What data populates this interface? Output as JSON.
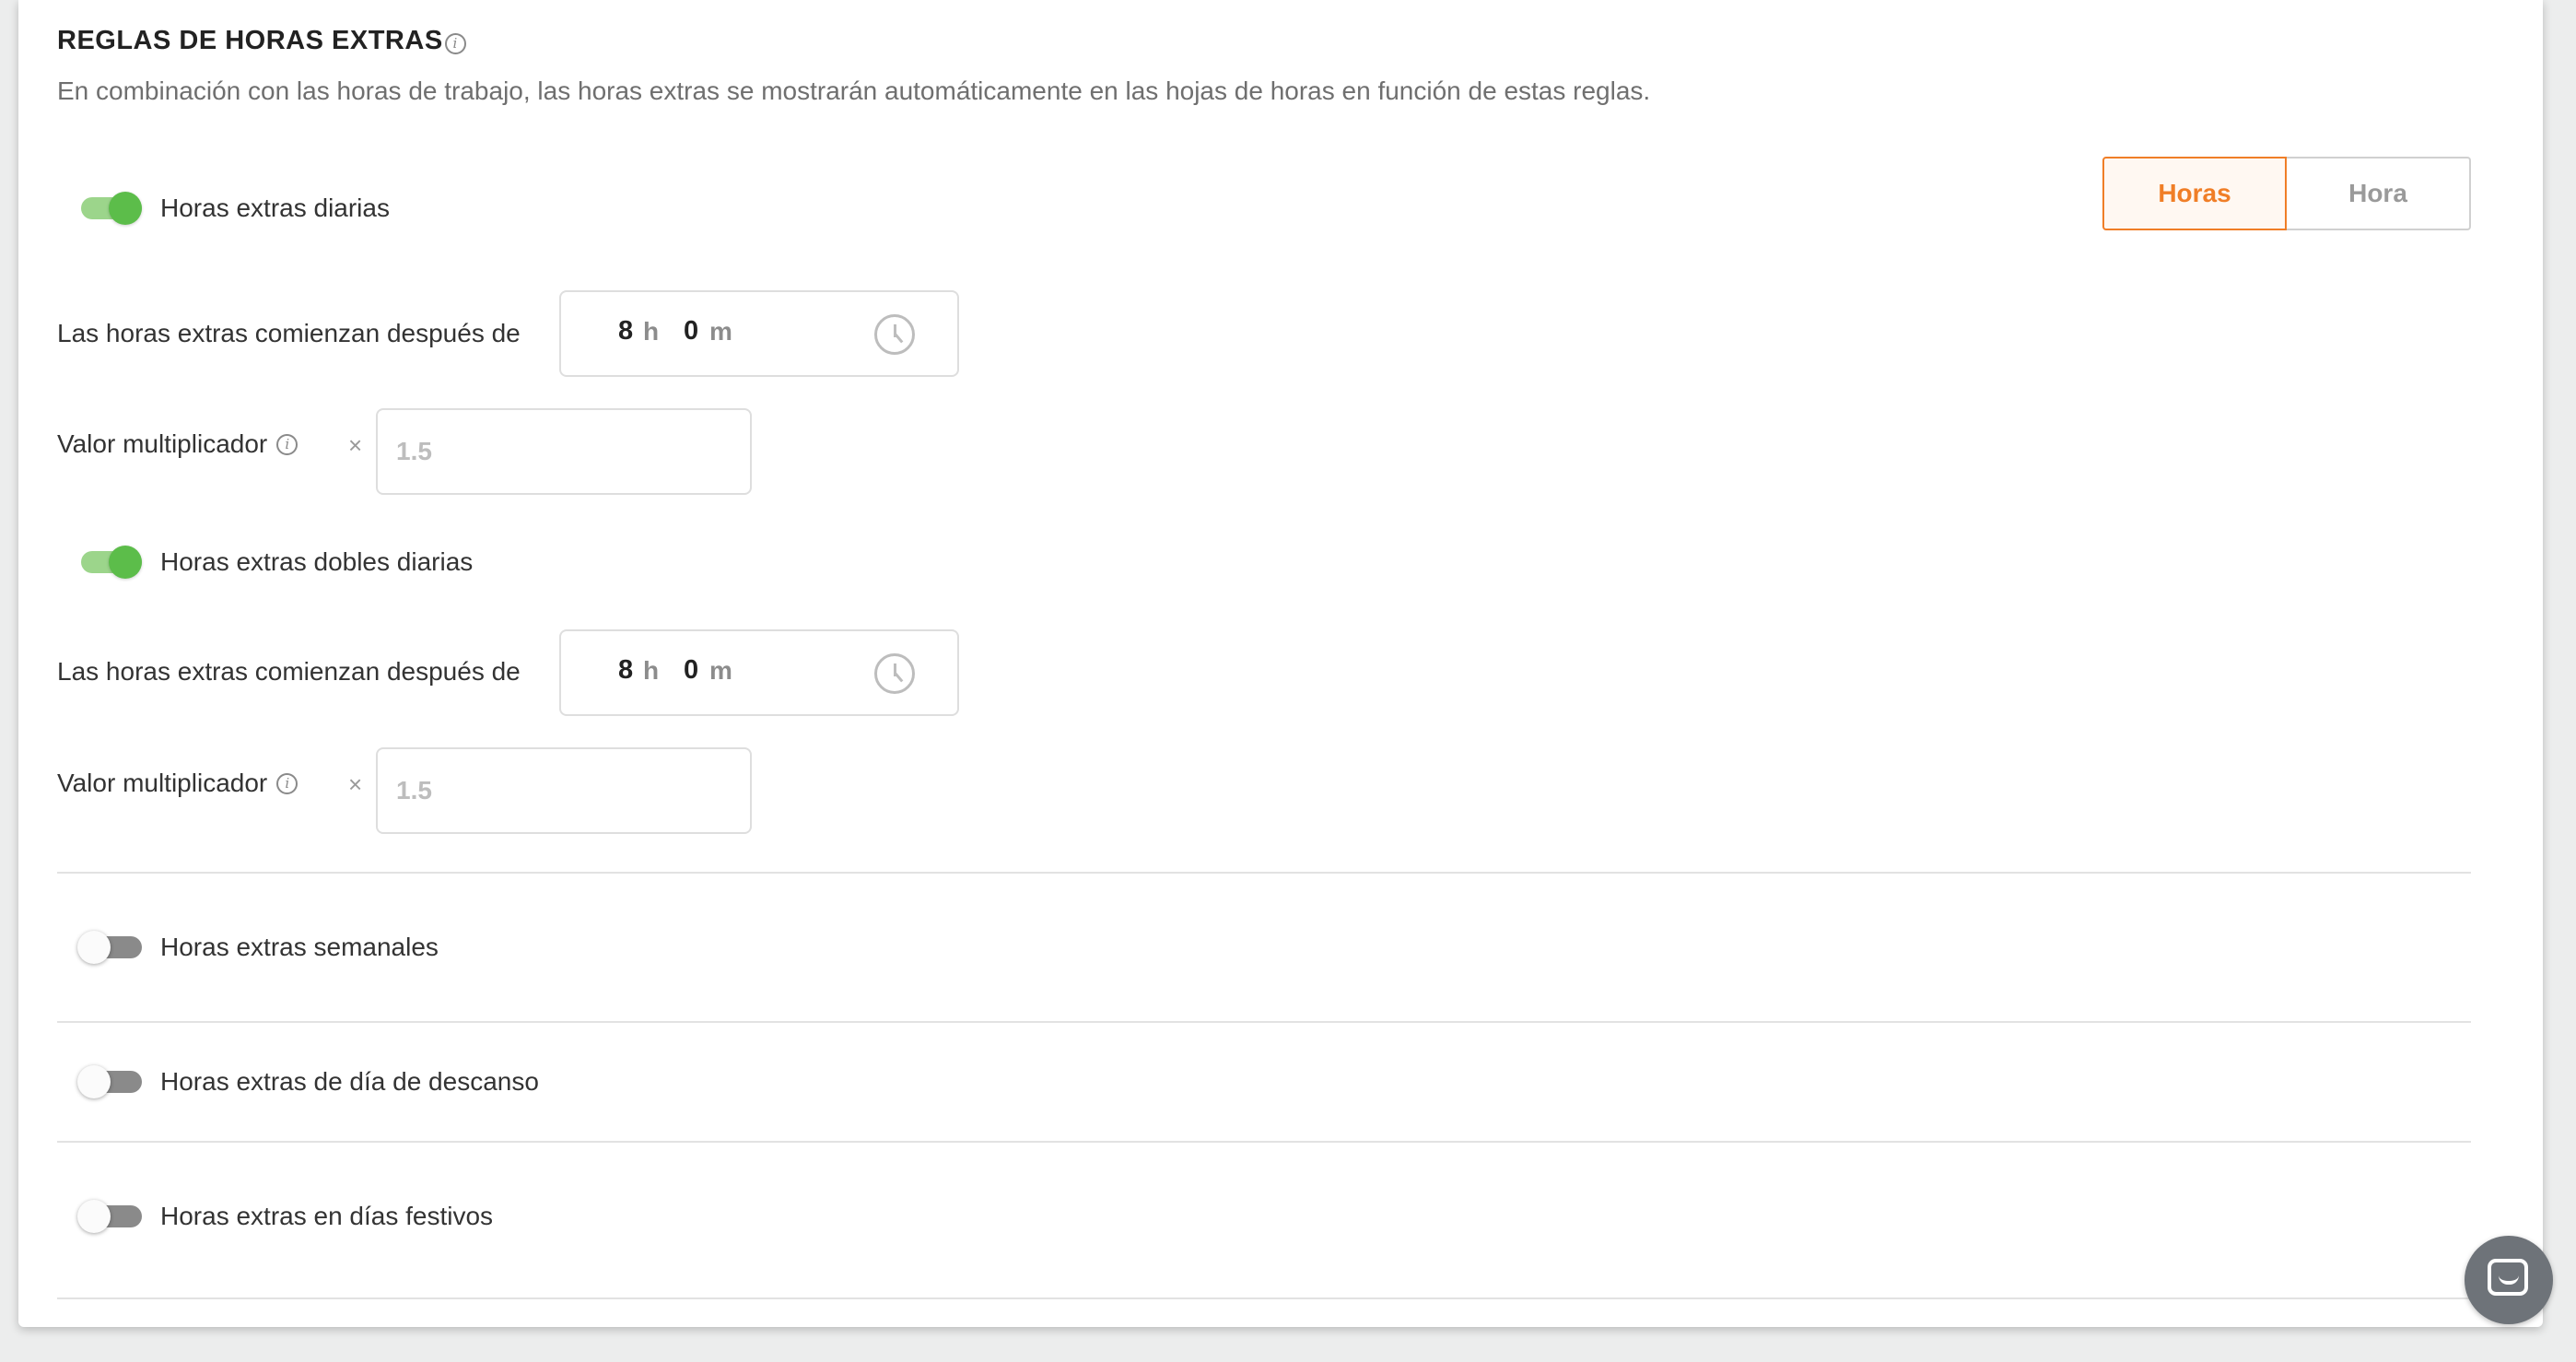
{
  "section": {
    "title": "REGLAS DE HORAS EXTRAS",
    "title_info_icon": "info-icon",
    "description": "En combinación con las horas de trabajo, las horas extras se mostrarán automáticamente en las hojas de horas en función de estas reglas."
  },
  "mode_toggle": {
    "options": [
      "Horas",
      "Hora"
    ],
    "selected": "Horas"
  },
  "daily_overtime": {
    "enabled": true,
    "label": "Horas extras diarias",
    "start_label": "Las horas extras comienzan después de",
    "hours": "8",
    "hours_unit": "h",
    "minutes": "0",
    "minutes_unit": "m",
    "multiplier_label": "Valor multiplicador",
    "times_symbol": "×",
    "multiplier_placeholder": "1.5"
  },
  "double_overtime": {
    "enabled": true,
    "label": "Horas extras dobles diarias",
    "start_label": "Las horas extras comienzan después de",
    "hours": "8",
    "hours_unit": "h",
    "minutes": "0",
    "minutes_unit": "m",
    "multiplier_label": "Valor multiplicador",
    "times_symbol": "×",
    "multiplier_placeholder": "1.5"
  },
  "weekly_overtime": {
    "enabled": false,
    "label": "Horas extras semanales"
  },
  "rest_day_overtime": {
    "enabled": false,
    "label": "Horas extras de día de descanso"
  },
  "holiday_overtime": {
    "enabled": false,
    "label": "Horas extras en días festivos"
  },
  "chat_widget": {
    "icon": "chat-bubble-icon"
  },
  "colors": {
    "accent": "#f07e27",
    "toggle_on": "#5cbd4a",
    "toggle_off": "#8a8a8a"
  }
}
